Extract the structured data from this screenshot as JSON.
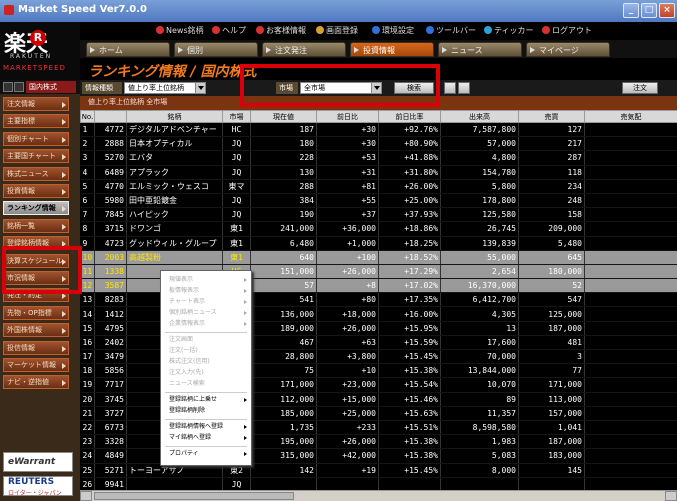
{
  "window": {
    "title": "Market Speed Ver7.0.0",
    "controls": [
      "_",
      "□",
      "×"
    ]
  },
  "logo": {
    "brand": "楽天",
    "mark": "R",
    "sub": "RAKUTEN",
    "product": "MARKETSPEED"
  },
  "topmenu": [
    {
      "label": "News銘柄",
      "color": "#d93030"
    },
    {
      "label": "ヘルプ",
      "color": "#d93030"
    },
    {
      "label": "お客様情報",
      "color": "#d93030"
    },
    {
      "label": "画面登録",
      "color": "#d9a030"
    },
    {
      "label": "環境設定",
      "color": "#3070d9"
    },
    {
      "label": "ツールバー",
      "color": "#3070d9"
    },
    {
      "label": "ティッカー",
      "color": "#30a0d9"
    },
    {
      "label": "ログアウト",
      "color": "#d93030"
    }
  ],
  "tabs": [
    "ホーム",
    "個別",
    "注文発注",
    "投資情報",
    "ニュース",
    "マイページ"
  ],
  "page": {
    "title": "ランキング情報 / 国内株式"
  },
  "sidebar": {
    "top_label": "国内株式",
    "items": [
      "注文情報",
      "主要指標",
      "個別チャート",
      "主要国チャート",
      "株式ニュース",
      "投資情報",
      "ランキング情報",
      "銘柄一覧",
      "登録銘柄情報",
      "決算スケジュール",
      "市況情報",
      "発注・約定",
      "先物・OP指標",
      "外国株情報",
      "投信情報",
      "マーケット情報",
      "ナビ・逆指値"
    ],
    "active": "ランキング情報",
    "ewarrant": "eWarrant",
    "reuters": {
      "name": "REUTERS",
      "sub": "ロイター・ジャパン"
    }
  },
  "filter": {
    "ranking_label": "情報種類",
    "ranking_value": "値上り率上位銘柄",
    "market_label": "市場",
    "market_value": "全市場",
    "search_button": "検索",
    "order_button": "注文"
  },
  "subtitle": "値上り率上位銘柄 全市場",
  "columns": [
    "No.",
    "",
    "銘柄",
    "市場",
    "現在値",
    "前日比",
    "前日比率",
    "出来高",
    "売買",
    "売気配"
  ],
  "rows": [
    {
      "no": "1",
      "code": "4772",
      "name": "デジタルアドベンチャー",
      "mkt": "HC",
      "price": "187",
      "chg": "+30",
      "pct": "+92.76%",
      "vol": "7,587,800",
      "trd": "127",
      "dir": "up"
    },
    {
      "no": "2",
      "code": "2888",
      "name": "日本オプティカル",
      "mkt": "JQ",
      "price": "180",
      "chg": "+30",
      "pct": "+80.90%",
      "vol": "57,000",
      "trd": "217",
      "dir": "dn"
    },
    {
      "no": "3",
      "code": "5270",
      "name": "エバタ",
      "mkt": "JQ",
      "price": "228",
      "chg": "+53",
      "pct": "+41.88%",
      "vol": "4,800",
      "trd": "287",
      "dir": "up"
    },
    {
      "no": "4",
      "code": "6489",
      "name": "アプラック",
      "mkt": "JQ",
      "price": "130",
      "chg": "+31",
      "pct": "+31.80%",
      "vol": "154,780",
      "trd": "118",
      "dir": "up"
    },
    {
      "no": "5",
      "code": "4770",
      "name": "エルミック・ウェスコ",
      "mkt": "東マ",
      "price": "288",
      "chg": "+81",
      "pct": "+26.00%",
      "vol": "5,800",
      "trd": "234",
      "dir": "up"
    },
    {
      "no": "6",
      "code": "5980",
      "name": "田中亜鉛鍍金",
      "mkt": "JQ",
      "price": "384",
      "chg": "+55",
      "pct": "+25.00%",
      "vol": "178,800",
      "trd": "248",
      "dir": "dn"
    },
    {
      "no": "7",
      "code": "7845",
      "name": "ハイピック",
      "mkt": "JQ",
      "price": "190",
      "chg": "+37",
      "pct": "+37.93%",
      "vol": "125,580",
      "trd": "158",
      "dir": "up"
    },
    {
      "no": "8",
      "code": "3715",
      "name": "ドワンゴ",
      "mkt": "東1",
      "price": "241,000",
      "chg": "+36,000",
      "pct": "+18.86%",
      "vol": "26,745",
      "trd": "209,000",
      "dir": "up"
    },
    {
      "no": "9",
      "code": "4723",
      "name": "グッドウィル・グループ",
      "mkt": "東1",
      "price": "6,480",
      "chg": "+1,000",
      "pct": "+18.25%",
      "vol": "139,839",
      "trd": "5,480",
      "dir": "up"
    },
    {
      "no": "10",
      "code": "2003",
      "name": "高越製粉",
      "mkt": "東1",
      "price": "640",
      "chg": "+100",
      "pct": "+18.52%",
      "vol": "55,000",
      "trd": "645",
      "dir": "up",
      "hl": true
    },
    {
      "no": "11",
      "code": "1338",
      "name": "",
      "mkt": "HC",
      "price": "151,000",
      "chg": "+26,000",
      "pct": "+17.29%",
      "vol": "2,654",
      "trd": "180,000",
      "dir": "up",
      "hl": true
    },
    {
      "no": "12",
      "code": "3587",
      "name": "",
      "mkt": "JQ",
      "price": "57",
      "chg": "+8",
      "pct": "+17.02%",
      "vol": "16,370,000",
      "trd": "52",
      "dir": "up",
      "hl": true
    },
    {
      "no": "13",
      "code": "8283",
      "name": "",
      "mkt": "東1",
      "price": "541",
      "chg": "+80",
      "pct": "+17.35%",
      "vol": "6,412,700",
      "trd": "547",
      "dir": "up"
    },
    {
      "no": "14",
      "code": "1412",
      "name": "",
      "mkt": "東1",
      "price": "136,000",
      "chg": "+18,000",
      "pct": "+16.00%",
      "vol": "4,305",
      "trd": "125,000",
      "dir": "up"
    },
    {
      "no": "15",
      "code": "4795",
      "name": "",
      "mkt": "東マ",
      "price": "189,000",
      "chg": "+26,000",
      "pct": "+15.95%",
      "vol": "13",
      "trd": "187,000",
      "dir": "up"
    },
    {
      "no": "16",
      "code": "2402",
      "name": "",
      "mkt": "東マ",
      "price": "467",
      "chg": "+63",
      "pct": "+15.59%",
      "vol": "17,600",
      "trd": "481",
      "dir": "up"
    },
    {
      "no": "17",
      "code": "3479",
      "name": "",
      "mkt": "JQ",
      "price": "28,800",
      "chg": "+3,800",
      "pct": "+15.45%",
      "vol": "70,000",
      "trd": "3",
      "dir": "up"
    },
    {
      "no": "18",
      "code": "5856",
      "name": "",
      "mkt": "東2",
      "price": "75",
      "chg": "+10",
      "pct": "+15.38%",
      "vol": "13,844,000",
      "trd": "77",
      "dir": "up"
    },
    {
      "no": "19",
      "code": "7717",
      "name": "",
      "mkt": "東マ",
      "price": "171,000",
      "chg": "+23,000",
      "pct": "+15.54%",
      "vol": "10,070",
      "trd": "171,000",
      "dir": "up"
    },
    {
      "no": "20",
      "code": "3745",
      "name": "",
      "mkt": "東マ",
      "price": "112,000",
      "chg": "+15,000",
      "pct": "+15.46%",
      "vol": "89",
      "trd": "113,000",
      "dir": "up"
    },
    {
      "no": "21",
      "code": "3727",
      "name": "",
      "mkt": "東マ",
      "price": "185,000",
      "chg": "+25,000",
      "pct": "+15.63%",
      "vol": "11,357",
      "trd": "157,000",
      "dir": "dn"
    },
    {
      "no": "22",
      "code": "6773",
      "name": "",
      "mkt": "東1",
      "price": "1,735",
      "chg": "+233",
      "pct": "+15.51%",
      "vol": "8,598,580",
      "trd": "1,041",
      "dir": "up"
    },
    {
      "no": "23",
      "code": "3328",
      "name": "",
      "mkt": "東マ",
      "price": "195,000",
      "chg": "+26,000",
      "pct": "+15.38%",
      "vol": "1,983",
      "trd": "187,000",
      "dir": "up"
    },
    {
      "no": "24",
      "code": "4849",
      "name": "",
      "mkt": "東マ",
      "price": "315,000",
      "chg": "+42,000",
      "pct": "+15.38%",
      "vol": "5,083",
      "trd": "183,000",
      "dir": "up"
    },
    {
      "no": "25",
      "code": "5271",
      "name": "トーヨーアサノ",
      "mkt": "東2",
      "price": "142",
      "chg": "+19",
      "pct": "+15.45%",
      "vol": "8,000",
      "trd": "145",
      "dir": "up"
    },
    {
      "no": "26",
      "code": "9941",
      "name": "",
      "mkt": "JQ",
      "price": "",
      "chg": "",
      "pct": "",
      "vol": "",
      "trd": "",
      "dir": "up"
    }
  ],
  "context_menu": [
    {
      "label": "現値表示",
      "disabled": true,
      "sub": true
    },
    {
      "label": "板情報表示",
      "disabled": true,
      "sub": true
    },
    {
      "label": "チャート表示",
      "disabled": true,
      "sub": true
    },
    {
      "label": "個別銘柄ニュース",
      "disabled": true,
      "sub": true
    },
    {
      "label": "企業情報表示",
      "disabled": true,
      "sub": true
    },
    {
      "sep": true
    },
    {
      "label": "注文画面",
      "disabled": true
    },
    {
      "label": "注文(一括)",
      "disabled": true
    },
    {
      "label": "株式注文(信用)",
      "disabled": true
    },
    {
      "label": "注文入力(先)",
      "disabled": true
    },
    {
      "label": "ニュース検索",
      "disabled": true
    },
    {
      "sep": true
    },
    {
      "label": "登録銘柄に上乗せ",
      "disabled": false,
      "sub": true
    },
    {
      "label": "登録銘柄削除",
      "disabled": false
    },
    {
      "sep": true
    },
    {
      "label": "登録銘柄情報へ登録",
      "disabled": false,
      "sub": true
    },
    {
      "label": "マイ銘柄へ登録",
      "disabled": false,
      "sub": true
    },
    {
      "sep": true
    },
    {
      "label": "プロパティ",
      "disabled": false,
      "sub": true
    }
  ]
}
